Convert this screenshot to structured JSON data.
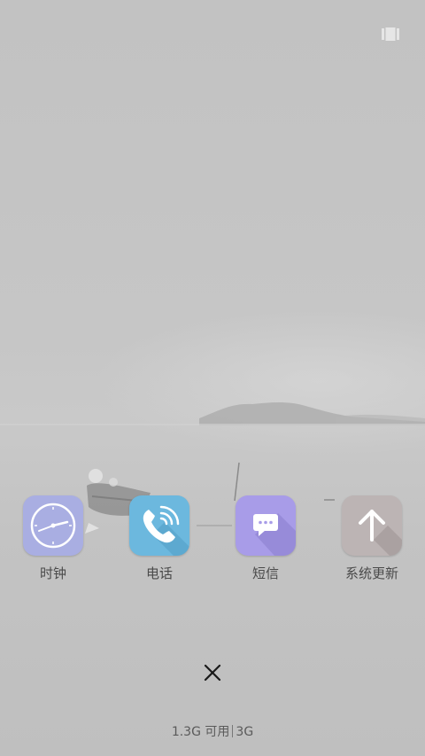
{
  "recents": {
    "apps": [
      {
        "label": "时钟",
        "icon": "clock-icon",
        "color": "#a9aee2"
      },
      {
        "label": "电话",
        "icon": "phone-icon",
        "color": "#6cb8de"
      },
      {
        "label": "短信",
        "icon": "message-icon",
        "color": "#a89ce8"
      },
      {
        "label": "系统更新",
        "icon": "upload-arrow-icon",
        "color": "#bcb4b4"
      }
    ],
    "memory_available": "1.3G 可用",
    "memory_total": "3G"
  }
}
